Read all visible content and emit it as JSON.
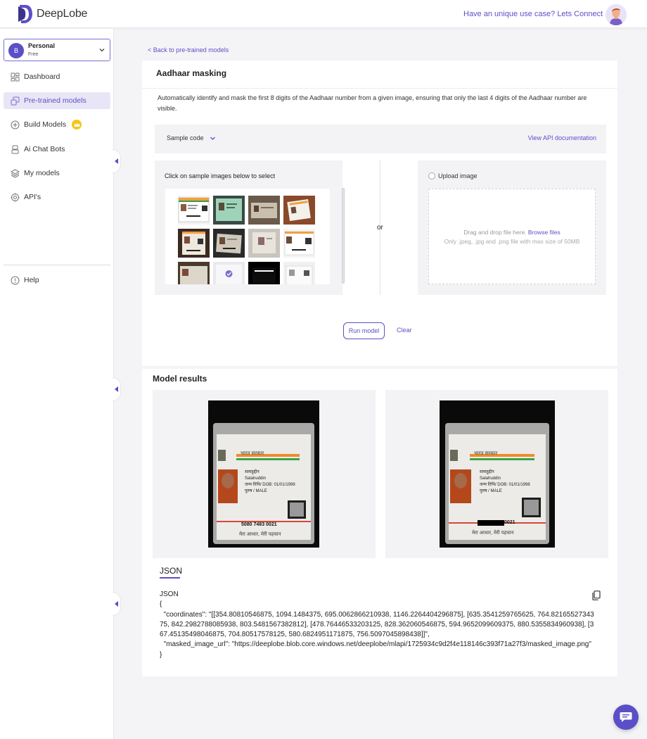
{
  "brand": {
    "name": "DeepLobe",
    "accent": "#5b4fc7"
  },
  "header": {
    "connect_text": "Have an unique use case? Lets Connect"
  },
  "account": {
    "initial": "B",
    "name": "Personal",
    "plan": "Free"
  },
  "sidebar": {
    "items": [
      {
        "label": "Dashboard",
        "icon": "dashboard-icon"
      },
      {
        "label": "Pre-trained models",
        "icon": "models-icon",
        "active": true
      },
      {
        "label": "Build Models",
        "icon": "plus-circle-icon",
        "badge": "crown-icon"
      },
      {
        "label": "Ai Chat Bots",
        "icon": "bot-icon"
      },
      {
        "label": "My models",
        "icon": "layers-icon"
      },
      {
        "label": "API's",
        "icon": "api-icon"
      }
    ],
    "help": "Help"
  },
  "page": {
    "back_link": "< Back to pre-trained models",
    "title": "Aadhaar masking",
    "description": "Automatically identify and mask the first 8 digits of the Aadhaar number from a given image, ensuring that only the last 4 digits of the Aadhaar number are visible.",
    "sample_code": "Sample code",
    "api_docs": "View API documentation",
    "samples_label": "Click on sample images below to select",
    "or": "or",
    "upload_label": "Upload image",
    "drop_text": "Drag and drop file here.",
    "browse": "Browse files",
    "drop_hint": "Only .jpeg, .jpg and .png file with max size of 50MB",
    "run_button": "Run model",
    "clear_button": "Clear"
  },
  "results": {
    "title": "Model results",
    "json_tab": "JSON",
    "card_text": {
      "heading": "भारत सरकार",
      "name_hindi": "सलाहुद्दीन",
      "name": "Salahuddin",
      "dob": "जन्म तिथि/ DOB: 01/01/1998",
      "gender": "पुरुष / MALE",
      "number": "5080 7483 0021",
      "masked_suffix": "0021",
      "footer": "मेरा आधार, मेरी पहचान"
    },
    "json_text": "JSON\n{\n  \"coordinates\": \"[[354.80810546875, 1094.1484375, 695.0062866210938, 1146.2264404296875], [635.3541259765625, 764.8216552734375, 842.2982788085938, 803.5481567382812], [478.76446533203125, 828.362060546875, 594.9652099609375, 880.5355834960938], [367.45135498046875, 704.80517578125, 580.6824951171875, 756.5097045898438]]\",\n  \"masked_image_url\": \"https://deeplobe.blob.core.windows.net/deeplobe/mlapi/1725934c9d2f4e118146c393f71a27f3/masked_image.png\"\n}"
  }
}
